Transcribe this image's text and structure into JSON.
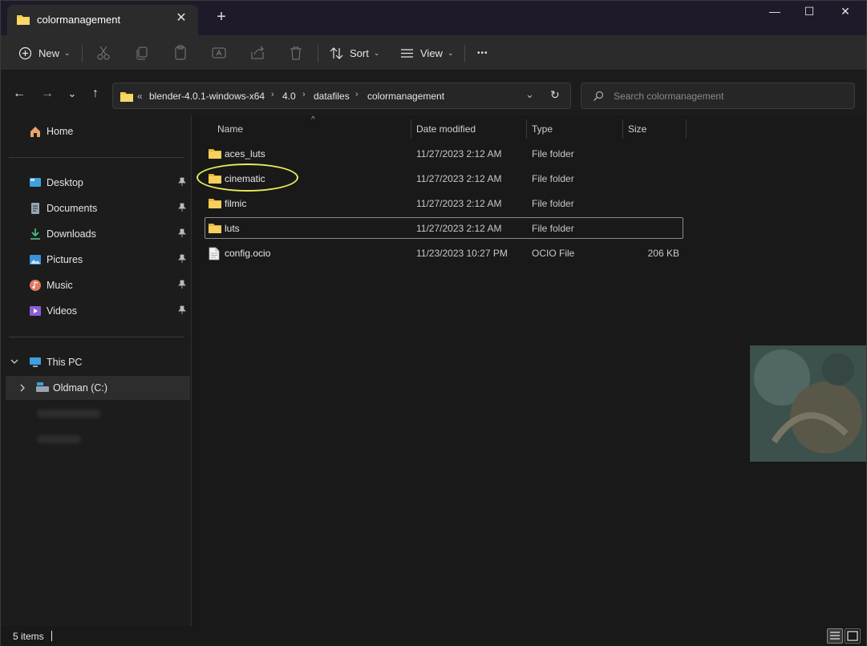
{
  "tab": {
    "title": "colormanagement",
    "close_glyph": "✕",
    "new_tab_glyph": "+"
  },
  "window_controls": {
    "minimize": "—",
    "maximize": "☐",
    "close": "✕"
  },
  "toolbar": {
    "new_label": "New",
    "sort_label": "Sort",
    "view_label": "View",
    "more_glyph": "•••",
    "dropdown_glyph": "⌄"
  },
  "nav": {
    "back": "←",
    "forward": "→",
    "recent": "⌄",
    "up": "↑"
  },
  "address": {
    "overflow": "«",
    "crumbs": [
      "blender-4.0.1-windows-x64",
      "4.0",
      "datafiles",
      "colormanagement"
    ],
    "separator": "›",
    "dropdown_glyph": "⌄",
    "refresh_glyph": "↻"
  },
  "search": {
    "placeholder": "Search colormanagement"
  },
  "sidebar": {
    "home": "Home",
    "quick_access": [
      {
        "label": "Desktop",
        "icon": "desktop-icon"
      },
      {
        "label": "Documents",
        "icon": "documents-icon"
      },
      {
        "label": "Downloads",
        "icon": "downloads-icon"
      },
      {
        "label": "Pictures",
        "icon": "pictures-icon"
      },
      {
        "label": "Music",
        "icon": "music-icon"
      },
      {
        "label": "Videos",
        "icon": "videos-icon"
      }
    ],
    "pin_glyph": "📌",
    "this_pc": "This PC",
    "drive": "Oldman (C:)"
  },
  "columns": {
    "name": "Name",
    "date": "Date modified",
    "type": "Type",
    "size": "Size",
    "sort_glyph": "^"
  },
  "files": [
    {
      "name": "aces_luts",
      "date": "11/27/2023 2:12 AM",
      "type": "File folder",
      "size": ""
    },
    {
      "name": "cinematic",
      "date": "11/27/2023 2:12 AM",
      "type": "File folder",
      "size": ""
    },
    {
      "name": "filmic",
      "date": "11/27/2023 2:12 AM",
      "type": "File folder",
      "size": ""
    },
    {
      "name": "luts",
      "date": "11/27/2023 2:12 AM",
      "type": "File folder",
      "size": ""
    },
    {
      "name": "config.ocio",
      "date": "11/23/2023 10:27 PM",
      "type": "OCIO File",
      "size": "206 KB"
    }
  ],
  "status": {
    "item_count": "5 items"
  },
  "colors": {
    "folder": "#f4c84a",
    "highlight_ring": "#e8ec5a",
    "titlebar": "#1f1a2a"
  }
}
